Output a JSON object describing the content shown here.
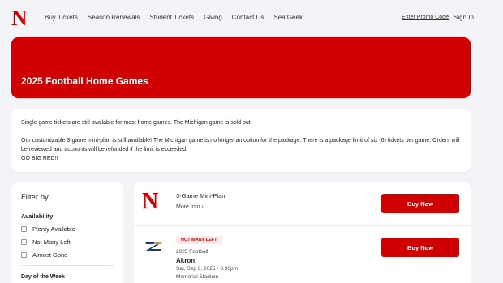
{
  "header": {
    "logo": "N",
    "nav": [
      "Buy Tickets",
      "Season Renewals",
      "Student Tickets",
      "Giving",
      "Contact Us",
      "SeatGeek"
    ],
    "promo_label": "Enter Promo Code",
    "signin_label": "Sign In"
  },
  "hero": {
    "title": "2025 Football Home Games"
  },
  "info": {
    "line1": "Single game tickets are still available for most home games. The Michigan game is sold out!",
    "line2": "Our customizable 3-game mini-plan is still available! The Michigan game is no longer an option for the package. There is a package limit of six (6) tickets per game. Orders will be reviewed and accounts will be refunded if the limit is exceeded.",
    "line3": "GO BIG RED!!"
  },
  "filter": {
    "title": "Filter by",
    "availability_heading": "Availability",
    "options": [
      "Plenty Available",
      "Not Many Left",
      "Almost Gone"
    ],
    "next_heading": "Day of the Week"
  },
  "events": [
    {
      "title": "3-Game Mini-Plan",
      "more_label": "More Info",
      "buy_label": "Buy Now",
      "logo": "N"
    },
    {
      "badge": "NOT MANY LEFT",
      "category": "2025 Football",
      "opponent": "Akron",
      "date": "Sat, Sep 6, 2025 • 6:30pm",
      "venue": "Memorial Stadium",
      "buy_label": "Buy Now"
    }
  ],
  "colors": {
    "brand": "#d00000",
    "background": "#f3f4f7"
  }
}
